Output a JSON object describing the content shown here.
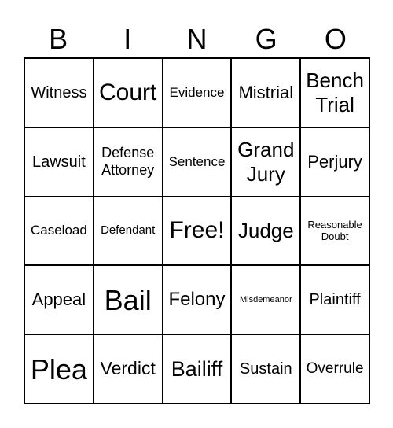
{
  "header": [
    "B",
    "I",
    "N",
    "G",
    "O"
  ],
  "rows": [
    [
      "Witness",
      "Court",
      "Evidence",
      "Mistrial",
      "Bench Trial"
    ],
    [
      "Lawsuit",
      "Defense Attorney",
      "Sentence",
      "Grand Jury",
      "Perjury"
    ],
    [
      "Caseload",
      "Defendant",
      "Free!",
      "Judge",
      "Reasonable Doubt"
    ],
    [
      "Appeal",
      "Bail",
      "Felony",
      "Misdemeanor",
      "Plaintiff"
    ],
    [
      "Plea",
      "Verdict",
      "Bailiff",
      "Sustain",
      "Overrule"
    ]
  ]
}
